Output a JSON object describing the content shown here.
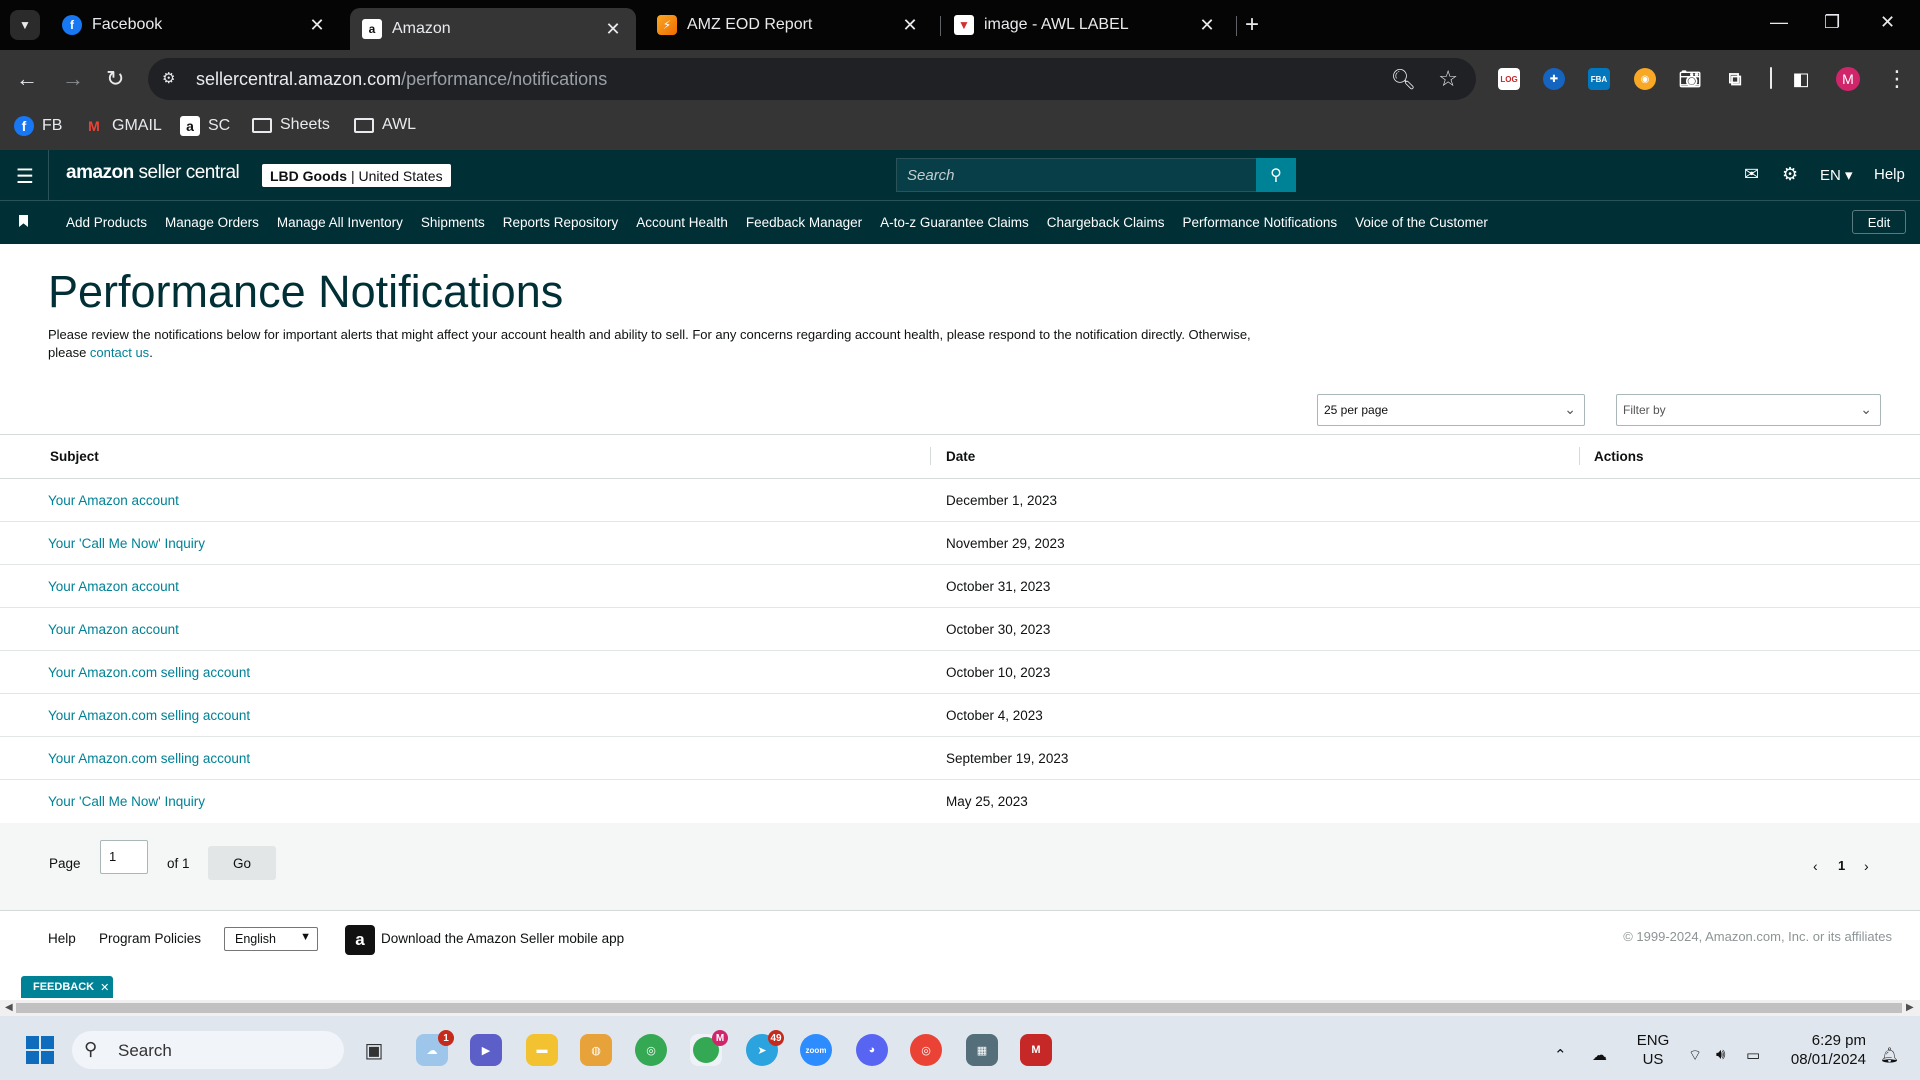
{
  "browser": {
    "tabs": [
      {
        "title": "Facebook",
        "favicon": "facebook-icon",
        "active": false
      },
      {
        "title": "Amazon",
        "favicon": "amazon-icon",
        "active": true
      },
      {
        "title": "AMZ EOD Report",
        "favicon": "report-icon",
        "active": false
      },
      {
        "title": "image - AWL LABEL",
        "favicon": "label-icon",
        "active": false
      }
    ],
    "url_host": "sellercentral.amazon.com",
    "url_path": "/performance/notifications",
    "profile_initial": "M",
    "bookmarks": [
      {
        "label": "FB",
        "icon": "facebook-icon"
      },
      {
        "label": "GMAIL",
        "icon": "gmail-icon"
      },
      {
        "label": "SC",
        "icon": "amazon-icon"
      },
      {
        "label": "Sheets",
        "icon": "folder-icon"
      },
      {
        "label": "AWL",
        "icon": "folder-icon"
      }
    ],
    "extensions": [
      "ext-red-icon",
      "ext-blue-icon",
      "FBA",
      "ext-orange-icon",
      "camera-icon",
      "puzzle-icon"
    ]
  },
  "header": {
    "logo_a": "amazon",
    "logo_b": " seller central",
    "store_name": "LBD Goods",
    "store_region": "United States",
    "search_placeholder": "Search",
    "language": "EN",
    "help": "Help"
  },
  "nav": {
    "items": [
      "Add Products",
      "Manage Orders",
      "Manage All Inventory",
      "Shipments",
      "Reports Repository",
      "Account Health",
      "Feedback Manager",
      "A-to-z Guarantee Claims",
      "Chargeback Claims",
      "Performance Notifications",
      "Voice of the Customer"
    ],
    "edit_label": "Edit"
  },
  "main": {
    "title": "Performance Notifications",
    "description": "Please review the notifications below for important alerts that might affect your account health and ability to sell. For any concerns regarding account health, please respond to the notification directly. Otherwise, please ",
    "contact_link": "contact us",
    "description_end": ".",
    "per_page": "25 per page",
    "filter_placeholder": "Filter by",
    "columns": {
      "subject": "Subject",
      "date": "Date",
      "actions": "Actions"
    },
    "rows": [
      {
        "subject": "Your Amazon account",
        "date": "December 1, 2023"
      },
      {
        "subject": "Your 'Call Me Now' Inquiry",
        "date": "November 29, 2023"
      },
      {
        "subject": "Your Amazon account",
        "date": "October 31, 2023"
      },
      {
        "subject": "Your Amazon account",
        "date": "October 30, 2023"
      },
      {
        "subject": "Your Amazon.com selling account",
        "date": "October 10, 2023"
      },
      {
        "subject": "Your Amazon.com selling account",
        "date": "October 4, 2023"
      },
      {
        "subject": "Your Amazon.com selling account",
        "date": "September 19, 2023"
      },
      {
        "subject": "Your 'Call Me Now' Inquiry",
        "date": "May 25, 2023"
      }
    ],
    "pager": {
      "page_label": "Page",
      "page_value": "1",
      "of_label": "of 1",
      "go": "Go",
      "current": "1"
    }
  },
  "footer": {
    "help": "Help",
    "policies": "Program Policies",
    "language": "English",
    "app_text": "Download the Amazon Seller mobile app",
    "copyright": "© 1999-2024, Amazon.com, Inc. or its affiliates",
    "feedback": "FEEDBACK"
  },
  "taskbar": {
    "search": "Search",
    "lang_top": "ENG",
    "lang_bottom": "US",
    "time": "6:29 pm",
    "date": "08/01/2024",
    "badges": {
      "weather": "1",
      "telegram": "49",
      "chrome_profile": "M"
    }
  }
}
